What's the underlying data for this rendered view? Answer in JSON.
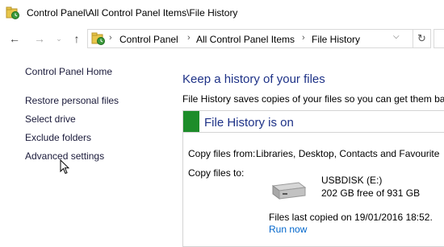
{
  "window": {
    "title": "Control Panel\\All Control Panel Items\\File History"
  },
  "nav": {
    "back_icon": "back-arrow-icon",
    "forward_icon": "forward-arrow-icon",
    "up_icon": "up-arrow-icon",
    "breadcrumbs": [
      "Control Panel",
      "All Control Panel Items",
      "File History"
    ],
    "refresh_icon": "refresh-icon"
  },
  "sidebar": {
    "items": [
      {
        "label": "Control Panel Home"
      },
      {
        "label": "Restore personal files"
      },
      {
        "label": "Select drive"
      },
      {
        "label": "Exclude folders"
      },
      {
        "label": "Advanced settings"
      }
    ]
  },
  "main": {
    "heading": "Keep a history of your files",
    "description": "File History saves copies of your files so you can get them bac",
    "status": {
      "title": "File History is on",
      "copy_from_label": "Copy files from:",
      "copy_from_value": "Libraries, Desktop, Contacts and Favourite",
      "copy_to_label": "Copy files to:",
      "drive_name": "USBDISK (E:)",
      "drive_free": "202 GB free of 931 GB",
      "last_copied": "Files last copied on 19/01/2016 18:52.",
      "run_now": "Run now"
    }
  },
  "colors": {
    "accent_blue": "#1e3287",
    "link_blue": "#0066cc",
    "status_green": "#1d8c2a"
  }
}
